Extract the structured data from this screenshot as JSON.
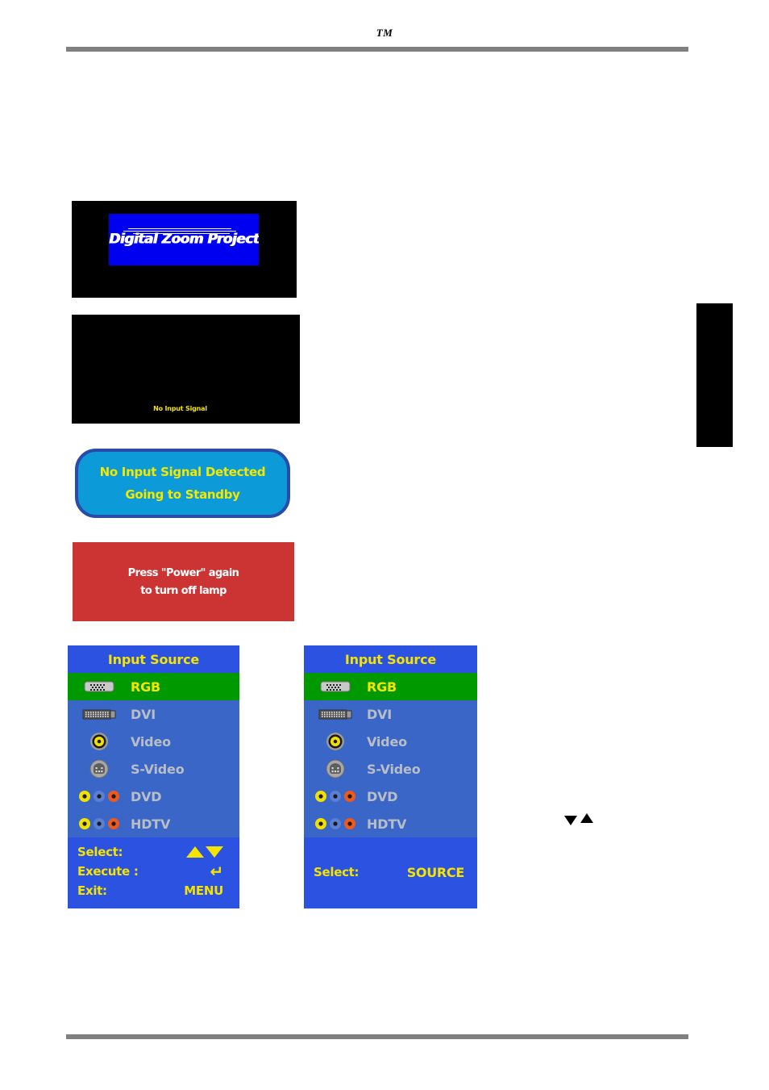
{
  "page": {
    "trademark": "TM"
  },
  "splash": {
    "logo_text": "Digital Zoom Projector",
    "plate_color": "#0000f0",
    "screen_color": "#000000"
  },
  "no_signal_screen": {
    "message": "No Input Signal",
    "text_color": "#f5e400",
    "screen_color": "#000000"
  },
  "standby_banner": {
    "line1": "No Input Signal Detected",
    "line2": "Going to Standby",
    "fill_color": "#0c9ad8",
    "border_color": "#2b4ba8",
    "text_color": "#f2e800"
  },
  "power_banner": {
    "line1": "Press \"Power\" again",
    "line2": "to turn off lamp",
    "fill_color": "#cc3333",
    "text_color": "#ffffff"
  },
  "osd_left": {
    "title": "Input Source",
    "title_color": "#f5e400",
    "title_bar_color": "#2b52e0",
    "body_color": "#3a66c8",
    "highlight_color": "#009900",
    "items": [
      {
        "label": "RGB",
        "icon": "vga-dsub-connector-icon",
        "selected": true
      },
      {
        "label": "DVI",
        "icon": "dvi-connector-icon",
        "selected": false
      },
      {
        "label": "Video",
        "icon": "rca-composite-jack-icon",
        "selected": false
      },
      {
        "label": "S-Video",
        "icon": "s-video-mini-din-icon",
        "selected": false
      },
      {
        "label": "DVD",
        "icon": "component-rca-triple-icon",
        "selected": false
      },
      {
        "label": "HDTV",
        "icon": "component-rca-triple-icon",
        "selected": false
      }
    ],
    "footer": [
      {
        "label": "Select:",
        "value": "",
        "glyph": "up-down-triangles"
      },
      {
        "label": "Execute :",
        "value": "",
        "glyph": "enter-arrow"
      },
      {
        "label": "Exit:",
        "value": "MENU",
        "glyph": ""
      }
    ]
  },
  "osd_right": {
    "title": "Input Source",
    "title_color": "#f5e400",
    "title_bar_color": "#2b52e0",
    "body_color": "#3a66c8",
    "highlight_color": "#009900",
    "items": [
      {
        "label": "RGB",
        "icon": "vga-dsub-connector-icon",
        "selected": true
      },
      {
        "label": "DVI",
        "icon": "dvi-connector-icon",
        "selected": false
      },
      {
        "label": "Video",
        "icon": "rca-composite-jack-icon",
        "selected": false
      },
      {
        "label": "S-Video",
        "icon": "s-video-mini-din-icon",
        "selected": false
      },
      {
        "label": "DVD",
        "icon": "component-rca-triple-icon",
        "selected": false
      },
      {
        "label": "HDTV",
        "icon": "component-rca-triple-icon",
        "selected": false
      }
    ],
    "footer": [
      {
        "label": "Select:",
        "value": "SOURCE",
        "glyph": ""
      }
    ]
  },
  "colors": {
    "rule": "#808080",
    "tab": "#000000",
    "osd_label": "#b9bec4"
  }
}
